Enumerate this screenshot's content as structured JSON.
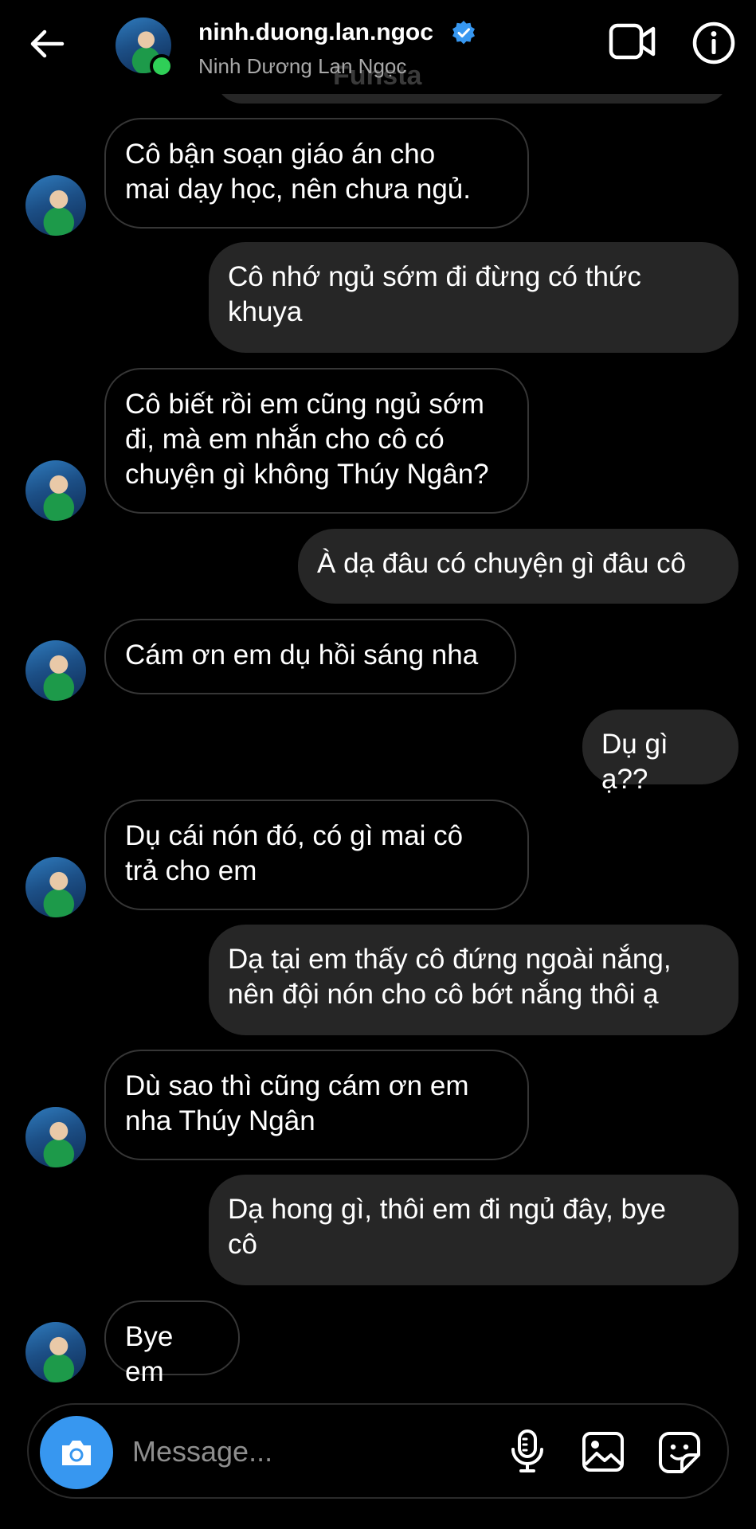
{
  "header": {
    "username": "ninh.duong.lan.ngoc",
    "display_name": "Ninh Dương Lan Ngọc",
    "ghost_text": "Funsta",
    "verified": true,
    "online": true,
    "icons": [
      "back-arrow-icon",
      "video-call-icon",
      "info-icon",
      "verified-badge-icon"
    ]
  },
  "messages": [
    {
      "side": "incoming",
      "text": "Cô bận soạn giáo án cho\nmai dạy học, nên chưa ngủ."
    },
    {
      "side": "outgoing",
      "text": "Cô nhớ ngủ sớm đi đừng có thức\nkhuya"
    },
    {
      "side": "incoming",
      "text": "Cô biết rồi em cũng ngủ sớm\nđi, mà em nhắn cho cô có\nchuyện gì không Thúy Ngân?"
    },
    {
      "side": "outgoing",
      "text": "À dạ đâu có chuyện gì đâu cô"
    },
    {
      "side": "incoming",
      "text": "Cám ơn em dụ hồi sáng nha"
    },
    {
      "side": "outgoing",
      "text": "Dụ gì ạ??"
    },
    {
      "side": "incoming",
      "text": "Dụ cái nón đó, có gì mai cô\ntrả cho em"
    },
    {
      "side": "outgoing",
      "text": "Dạ tại em thấy cô đứng ngoài nắng,\nnên đội nón cho cô bớt nắng thôi ạ"
    },
    {
      "side": "incoming",
      "text": "Dù sao thì cũng cám ơn em\nnha Thúy Ngân"
    },
    {
      "side": "outgoing",
      "text": "Dạ hong gì, thôi em đi ngủ đây, bye\ncô"
    },
    {
      "side": "incoming",
      "text": "Bye em"
    }
  ],
  "composer": {
    "placeholder": "Message...",
    "icons": [
      "camera-icon",
      "microphone-icon",
      "gallery-icon",
      "sticker-icon"
    ]
  },
  "colors": {
    "background": "#000000",
    "outgoing_bubble": "#262626",
    "incoming_border": "#363636",
    "accent": "#3797f0",
    "verified": "#3797f0",
    "online": "#2fcf57"
  }
}
